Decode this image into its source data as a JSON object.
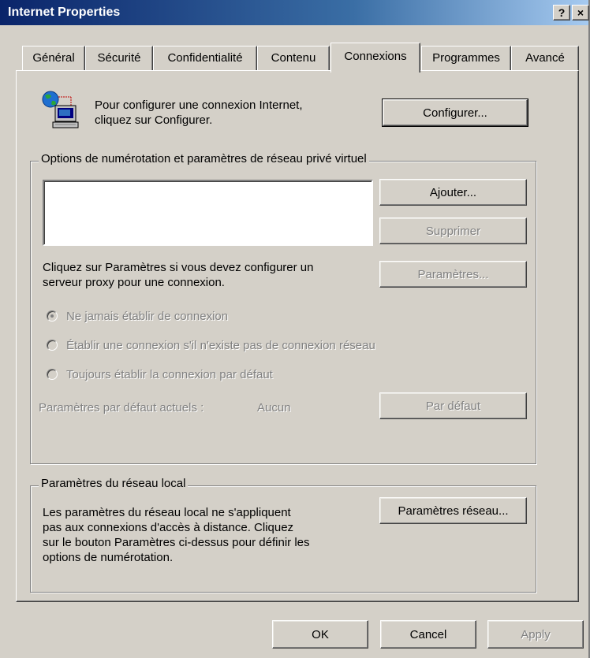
{
  "window": {
    "title": "Internet Properties",
    "help_label": "?",
    "close_label": "×"
  },
  "tabs": [
    {
      "label": "Général"
    },
    {
      "label": "Sécurité"
    },
    {
      "label": "Confidentialité"
    },
    {
      "label": "Contenu"
    },
    {
      "label": "Connexions",
      "active": true
    },
    {
      "label": "Programmes"
    },
    {
      "label": "Avancé"
    }
  ],
  "setup": {
    "text_line1": "Pour configurer une connexion Internet,",
    "text_line2": "cliquez sur Configurer.",
    "configure_button": "Configurer..."
  },
  "dialup": {
    "group_title": "Options de numérotation et paramètres de réseau privé virtuel",
    "add_button": "Ajouter...",
    "remove_button": "Supprimer",
    "proxy_text_line1": "Cliquez sur Paramètres si vous devez configurer un",
    "proxy_text_line2": "serveur proxy pour une connexion.",
    "settings_button": "Paramètres...",
    "radio_never": "Ne jamais établir de connexion",
    "radio_when_none": "Établir une connexion s'il n'existe pas de connexion réseau",
    "radio_always": "Toujours établir la connexion par défaut",
    "current_default_label": "Paramètres par défaut actuels :",
    "current_default_value": "Aucun",
    "set_default_button": "Par défaut"
  },
  "lan": {
    "group_title": "Paramètres du réseau local",
    "text_line1": "Les paramètres du réseau local ne s'appliquent",
    "text_line2": "pas aux connexions d'accès à distance. Cliquez",
    "text_line3": "sur le bouton Paramètres ci-dessus pour définir les",
    "text_line4": "options de numérotation.",
    "lan_settings_button": "Paramètres réseau..."
  },
  "footer": {
    "ok_button": "OK",
    "cancel_button": "Cancel",
    "apply_button": "Apply"
  }
}
